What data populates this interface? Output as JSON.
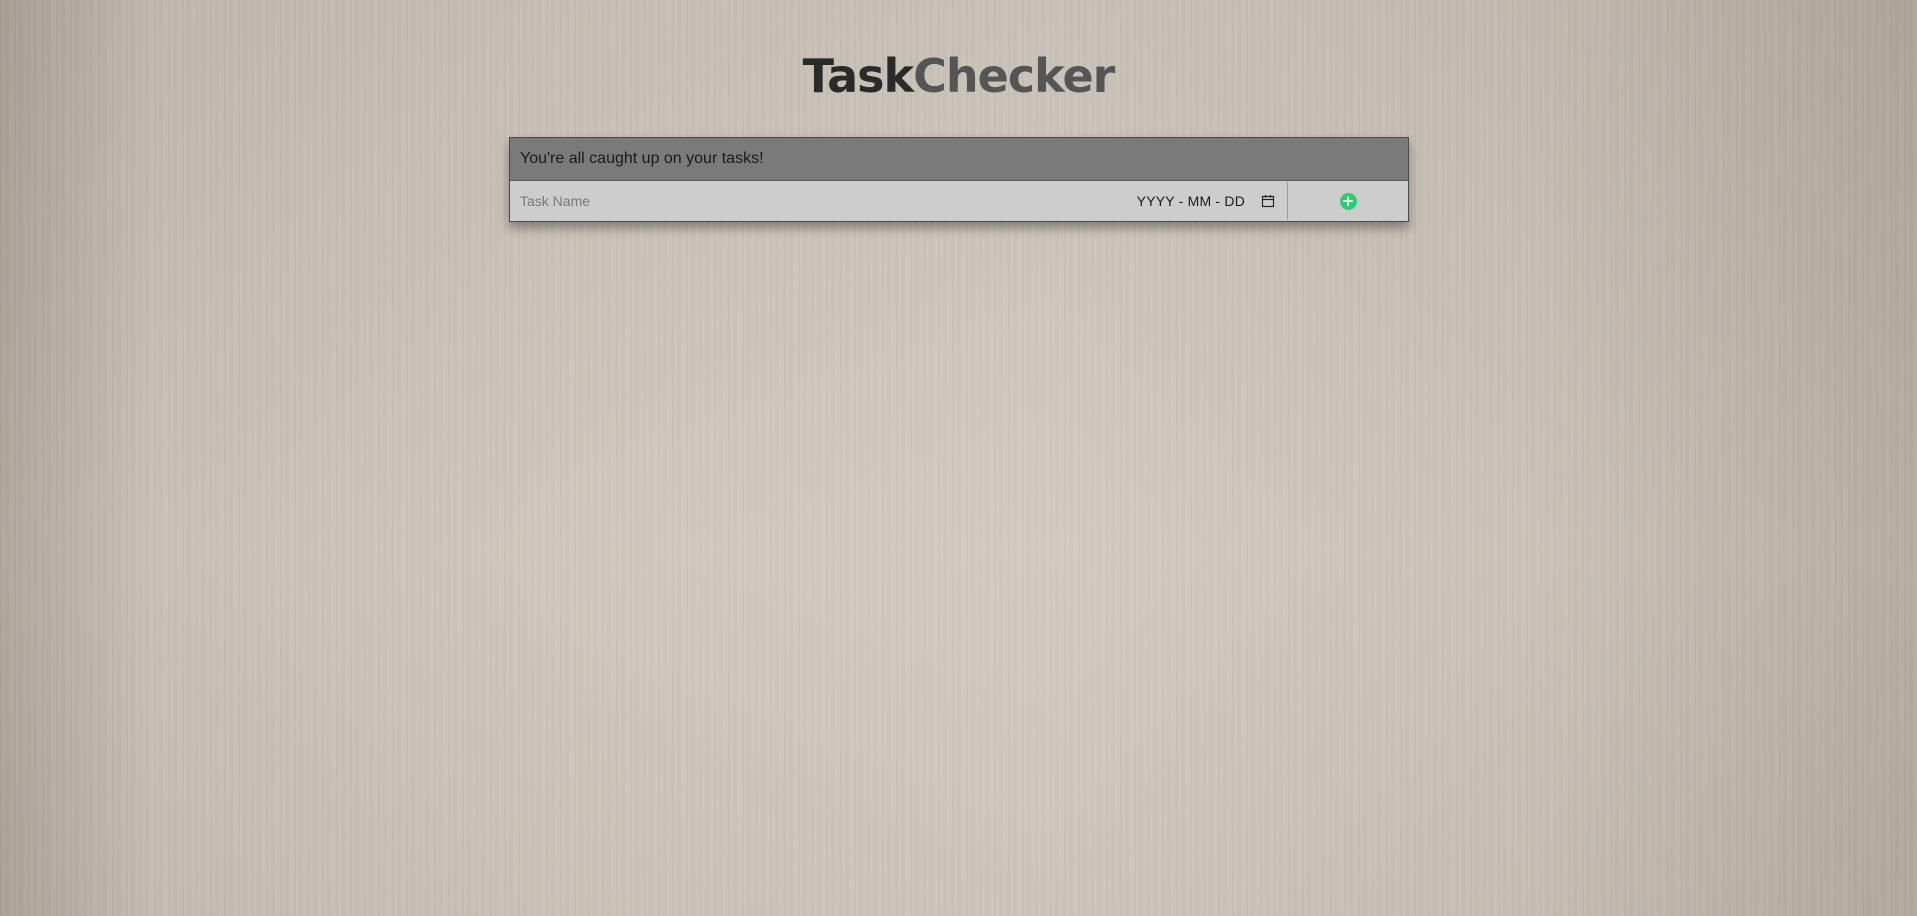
{
  "app": {
    "title_part1": "Task",
    "title_part2": "Checker"
  },
  "status": {
    "message": "You're all caught up on your tasks!"
  },
  "new_task": {
    "name_placeholder": "Task Name",
    "date_placeholder": "YYYY - MM - DD",
    "add_icon": "plus-circle-icon",
    "add_symbol": "+",
    "add_color": "#2ecc71"
  },
  "colors": {
    "status_bar": "#7a7a7a",
    "input_row": "#cdcdcd",
    "title_dark": "#2a2a2a",
    "title_light": "#555555"
  }
}
